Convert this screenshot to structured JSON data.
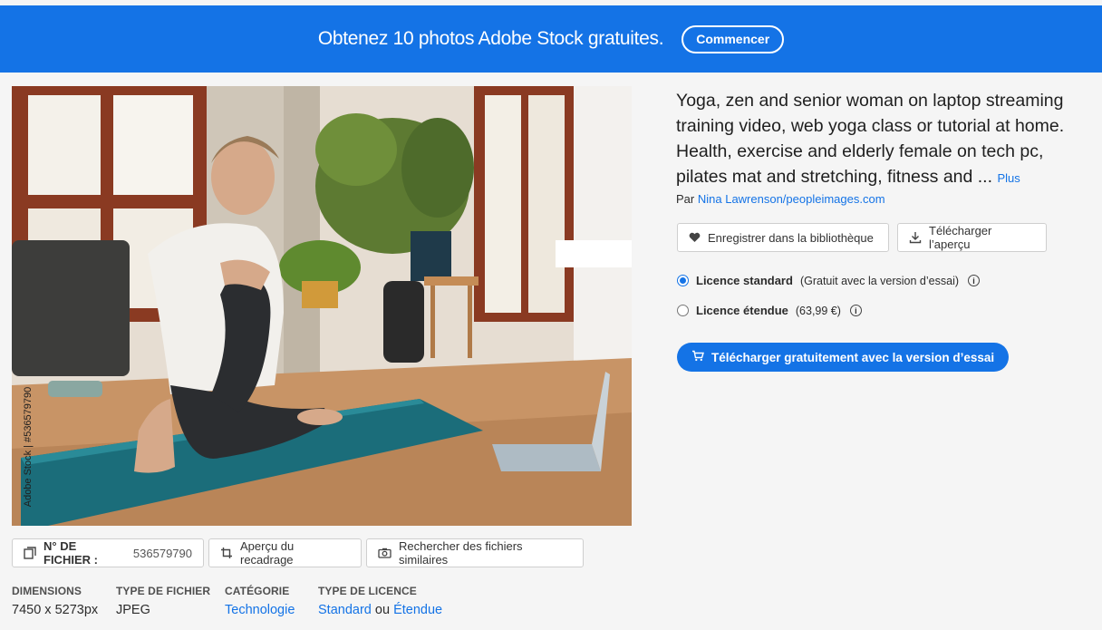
{
  "promo": {
    "text": "Obtenez 10 photos Adobe Stock gratuites.",
    "button": "Commencer"
  },
  "image": {
    "watermark": "Adobe Stock | #536579790",
    "subject": "woman-yoga-mat-laptop-photo"
  },
  "asset": {
    "title": "Yoga, zen and senior woman on laptop streaming training video, web yoga class or tutorial at home. Health, exercise and elderly female on tech pc, pilates mat and stretching, fitness and ...",
    "more": "Plus",
    "by_prefix": "Par",
    "author": "Nina Lawrenson/peopleimages.com"
  },
  "actions": {
    "save_library": "Enregistrer dans la bibliothèque",
    "download_preview": "Télécharger l’aperçu"
  },
  "licenses": [
    {
      "name": "Licence standard",
      "detail": "(Gratuit avec la version d’essai)",
      "selected": true
    },
    {
      "name": "Licence étendue",
      "detail": "(63,99 €)",
      "selected": false
    }
  ],
  "cta": {
    "label": "Télécharger gratuitement avec la version d’essai"
  },
  "file_actions": {
    "file_label": "N° DE FICHIER :",
    "file_number": "536579790",
    "crop_preview": "Aperçu du recadrage",
    "find_similar": "Rechercher des fichiers similaires"
  },
  "meta": {
    "dimensions": {
      "label": "DIMENSIONS",
      "value": "7450 x 5273px"
    },
    "file_type": {
      "label": "TYPE DE FICHIER",
      "value": "JPEG"
    },
    "category": {
      "label": "CATÉGORIE",
      "value": "Technologie"
    },
    "license_type": {
      "label": "TYPE DE LICENCE",
      "standard": "Standard",
      "or": "ou",
      "extended": "Étendue"
    }
  },
  "colors": {
    "accent": "#1473e6",
    "background": "#f5f5f5"
  }
}
